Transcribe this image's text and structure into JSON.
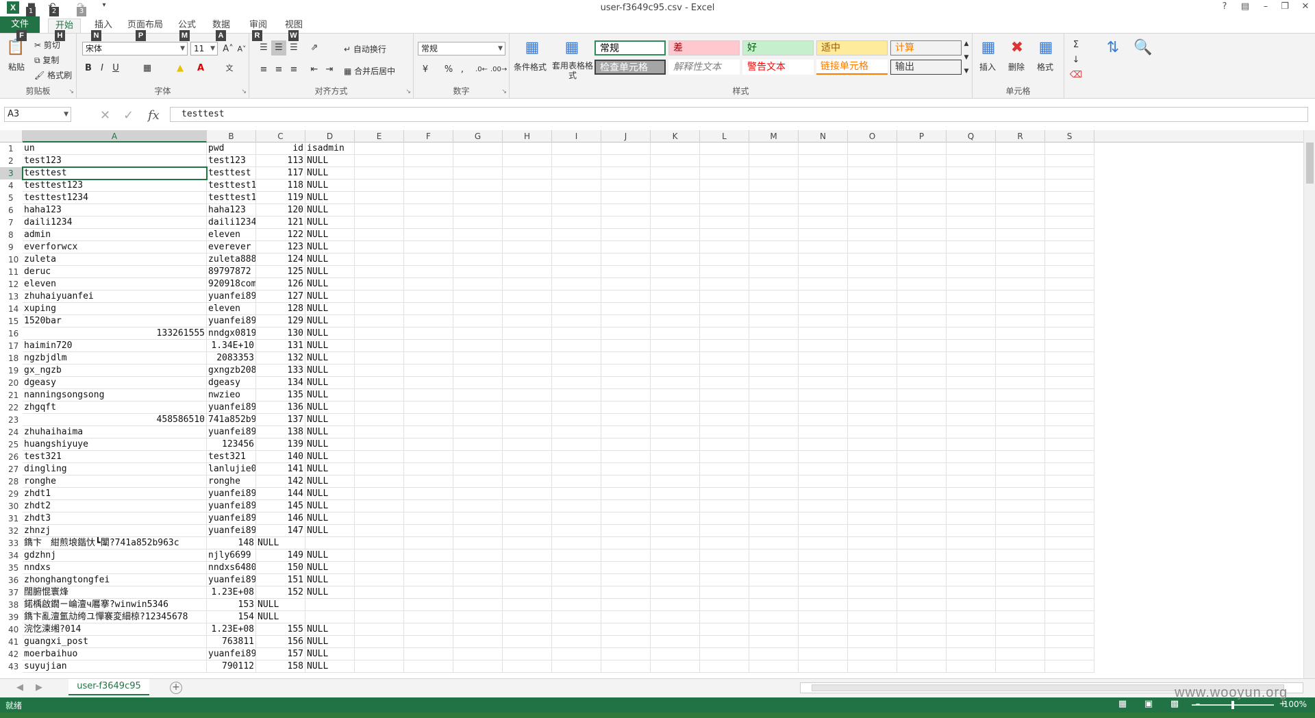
{
  "window": {
    "title": "user-f3649c95.csv - Excel"
  },
  "quick_access": {
    "keytips": [
      "1",
      "2",
      "3"
    ]
  },
  "tabs": [
    {
      "label": "文件",
      "keytip": "F"
    },
    {
      "label": "开始",
      "keytip": "H"
    },
    {
      "label": "插入",
      "keytip": "N"
    },
    {
      "label": "页面布局",
      "keytip": "P"
    },
    {
      "label": "公式",
      "keytip": "M"
    },
    {
      "label": "数据",
      "keytip": "A"
    },
    {
      "label": "审阅",
      "keytip": "R"
    },
    {
      "label": "视图",
      "keytip": "W"
    }
  ],
  "ribbon": {
    "clipboard": {
      "label": "剪贴板",
      "paste": "粘贴",
      "cut": "剪切",
      "copy": "复制",
      "format_painter": "格式刷"
    },
    "font": {
      "label": "字体",
      "font_name": "宋体",
      "font_size": "11",
      "bold": "B",
      "italic": "I",
      "underline": "U"
    },
    "alignment": {
      "label": "对齐方式",
      "wrap_text": "自动换行",
      "merge_center": "合并后居中"
    },
    "number": {
      "label": "数字",
      "format": "常规",
      "percent": "%",
      "comma": ","
    },
    "styles": {
      "label": "样式",
      "conditional_format": "条件格式",
      "table_format": "套用表格格式",
      "cells": [
        {
          "label": "常规",
          "bg": "#ffffff",
          "color": "#000000",
          "border": "#2e8b57"
        },
        {
          "label": "差",
          "bg": "#ffc7ce",
          "color": "#9c0006"
        },
        {
          "label": "好",
          "bg": "#c6efce",
          "color": "#006100"
        },
        {
          "label": "适中",
          "bg": "#ffeb9c",
          "color": "#9c5700"
        },
        {
          "label": "计算",
          "bg": "#f2f2f2",
          "color": "#fa7d00"
        },
        {
          "label": "检查单元格",
          "bg": "#a5a5a5",
          "color": "#ffffff"
        },
        {
          "label": "解释性文本",
          "bg": "#ffffff",
          "color": "#7f7f7f"
        },
        {
          "label": "警告文本",
          "bg": "#ffffff",
          "color": "#ff0000"
        },
        {
          "label": "链接单元格",
          "bg": "#ffffff",
          "color": "#fa7d00"
        },
        {
          "label": "输出",
          "bg": "#f2f2f2",
          "color": "#3f3f3f"
        }
      ]
    },
    "cells": {
      "label": "单元格",
      "insert": "插入",
      "delete": "删除",
      "format": "格式"
    }
  },
  "formula_bar": {
    "name_box": "A3",
    "fx": "fx",
    "content": "testtest"
  },
  "grid": {
    "columns": [
      "A",
      "B",
      "C",
      "D",
      "E",
      "F",
      "G",
      "H",
      "I",
      "J",
      "K",
      "L",
      "M",
      "N",
      "O",
      "P",
      "Q",
      "R",
      "S"
    ],
    "selected_column": "A",
    "selected_row": 3,
    "rows": [
      {
        "n": "1",
        "a": "un",
        "b": "pwd",
        "c": "id",
        "d": "isadmin"
      },
      {
        "n": "2",
        "a": "test123",
        "b": "test123",
        "c": "113",
        "d": "NULL"
      },
      {
        "n": "3",
        "a": "testtest",
        "b": "testtest",
        "c": "117",
        "d": "NULL"
      },
      {
        "n": "4",
        "a": "testtest123",
        "b": "testtest1",
        "c": "118",
        "d": "NULL"
      },
      {
        "n": "5",
        "a": "testtest1234",
        "b": "testtest1",
        "c": "119",
        "d": "NULL"
      },
      {
        "n": "6",
        "a": "haha123",
        "b": "haha123",
        "c": "120",
        "d": "NULL"
      },
      {
        "n": "7",
        "a": "daili1234",
        "b": "daili1234",
        "c": "121",
        "d": "NULL"
      },
      {
        "n": "8",
        "a": "admin",
        "b": "eleven",
        "c": "122",
        "d": "NULL"
      },
      {
        "n": "9",
        "a": "everforwcx",
        "b": "everever",
        "c": "123",
        "d": "NULL"
      },
      {
        "n": "10",
        "a": "zuleta",
        "b": "zuleta888",
        "c": "124",
        "d": "NULL"
      },
      {
        "n": "11",
        "a": "deruc",
        "b": "89797872",
        "c": "125",
        "d": "NULL"
      },
      {
        "n": "12",
        "a": "eleven",
        "b": "920918com",
        "c": "126",
        "d": "NULL"
      },
      {
        "n": "13",
        "a": "zhuhaiyuanfei",
        "b": "yuanfei89",
        "c": "127",
        "d": "NULL"
      },
      {
        "n": "14",
        "a": "xuping",
        "b": "eleven",
        "c": "128",
        "d": "NULL"
      },
      {
        "n": "15",
        "a": "1520bar",
        "b": "yuanfei89",
        "c": "129",
        "d": "NULL"
      },
      {
        "n": "16",
        "a_num": "133261555",
        "b": "nndgx0819",
        "c": "130",
        "d": "NULL"
      },
      {
        "n": "17",
        "a": "haimin720",
        "b_num": "1.34E+10",
        "c": "131",
        "d": "NULL"
      },
      {
        "n": "18",
        "a": "ngzbjdlm",
        "b_num": "2083353",
        "c": "132",
        "d": "NULL"
      },
      {
        "n": "19",
        "a": "gx_ngzb",
        "b": "gxngzb208",
        "c": "133",
        "d": "NULL"
      },
      {
        "n": "20",
        "a": "dgeasy",
        "b": "dgeasy",
        "c": "134",
        "d": "NULL"
      },
      {
        "n": "21",
        "a": "nanningsongsong",
        "b": "nwzieo",
        "c": "135",
        "d": "NULL"
      },
      {
        "n": "22",
        "a": "zhgqft",
        "b": "yuanfei89",
        "c": "136",
        "d": "NULL"
      },
      {
        "n": "23",
        "a_num": "458586510",
        "b": "741a852b9",
        "c": "137",
        "d": "NULL"
      },
      {
        "n": "24",
        "a": "zhuhaihaima",
        "b": "yuanfei89",
        "c": "138",
        "d": "NULL"
      },
      {
        "n": "25",
        "a": "huangshiyuye",
        "b_num": "123456",
        "c": "139",
        "d": "NULL"
      },
      {
        "n": "26",
        "a": "test321",
        "b": "test321",
        "c": "140",
        "d": "NULL"
      },
      {
        "n": "27",
        "a": "dingling",
        "b": "lanlujie0",
        "c": "141",
        "d": "NULL"
      },
      {
        "n": "28",
        "a": "ronghe",
        "b": "ronghe",
        "c": "142",
        "d": "NULL"
      },
      {
        "n": "29",
        "a": "zhdt1",
        "b": "yuanfei89",
        "c": "144",
        "d": "NULL"
      },
      {
        "n": "30",
        "a": "zhdt2",
        "b": "yuanfei89",
        "c": "145",
        "d": "NULL"
      },
      {
        "n": "31",
        "a": "zhdt3",
        "b": "yuanfei89",
        "c": "146",
        "d": "NULL"
      },
      {
        "n": "32",
        "a": "zhnzj",
        "b": "yuanfei89",
        "c": "147",
        "d": "NULL"
      },
      {
        "n": "33",
        "a_wide": "鐫卞　紺煎埌鍇忕┗闈?741a852b963c",
        "b_num": "148",
        "c_plain": "NULL"
      },
      {
        "n": "34",
        "a": "gdzhnj",
        "b": "njly6699",
        "c": "149",
        "d": "NULL"
      },
      {
        "n": "35",
        "a": "nndxs",
        "b": "nndxs6480",
        "c": "150",
        "d": "NULL"
      },
      {
        "n": "36",
        "a": "zhonghangtongfei",
        "b": "yuanfei89",
        "c": "151",
        "d": "NULL"
      },
      {
        "n": "37",
        "a": "闊腑惃寰烽",
        "b_num": "1.23E+08",
        "c": "152",
        "d": "NULL"
      },
      {
        "n": "38",
        "a_wide": "鍩楀啟鐗ㄧ崘澶ч厬搴?winwin5346",
        "b_num": "153",
        "c_plain": "NULL"
      },
      {
        "n": "39",
        "a_wide": "鐫卞亂澶氳劥绔ユ憚褰変細椋?12345678",
        "b_num": "154",
        "c_plain": "NULL"
      },
      {
        "n": "40",
        "a": "浣忔湅缃?014",
        "b_num": "1.23E+08",
        "c": "155",
        "d": "NULL"
      },
      {
        "n": "41",
        "a": "guangxi_post",
        "b_num": "763811",
        "c": "156",
        "d": "NULL"
      },
      {
        "n": "42",
        "a": "moerbaihuo",
        "b": "yuanfei89",
        "c": "157",
        "d": "NULL"
      },
      {
        "n": "43",
        "a": "suyujian",
        "b_num": "790112",
        "c": "158",
        "d": "NULL"
      }
    ]
  },
  "sheet_tabs": [
    {
      "label": "user-f3649c95"
    }
  ],
  "status": {
    "text": "就绪",
    "zoom": "100%"
  },
  "watermark": "www.wooyun.org"
}
